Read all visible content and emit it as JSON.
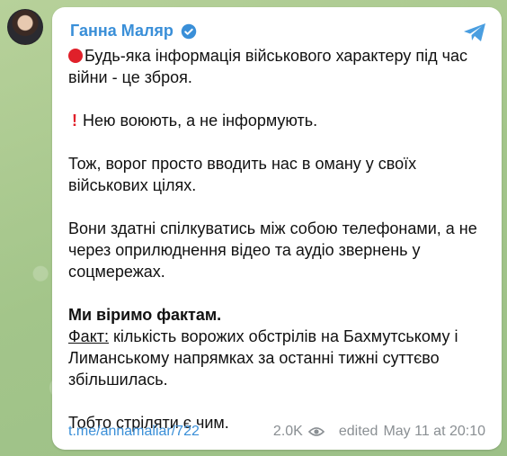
{
  "post": {
    "author": "Ганна Маляр",
    "line1": "Будь-яка інформація військового характеру під час війни - це зброя.",
    "line2": "Нею воюють, а не інформують.",
    "line3": "Тож, ворог просто вводить нас в оману у своїх військових цілях.",
    "line4": "Вони здатні спілкуватись між собою телефонами, а не через оприлюднення відео та аудіо звернень у соцмережах.",
    "line5_bold": "Ми віримо фактам.",
    "fact_label": "Факт:",
    "fact_text": " кількість ворожих обстрілів на Бахмутському і Лиманському напрямках за останні тижні суттєво збільшилась.",
    "line6": "Тобто стріляти є чим.",
    "link": "t.me/annamaliar/722",
    "views": "2.0K",
    "edited_label": "edited",
    "date": "May 11 at 20:10"
  },
  "colors": {
    "accent": "#3a8fd8",
    "red": "#e0202a",
    "meta": "#8a8f93"
  },
  "icons": [
    "verified-badge-icon",
    "telegram-share-icon",
    "red-circle-emoji",
    "exclamation-emoji",
    "eye-icon"
  ]
}
